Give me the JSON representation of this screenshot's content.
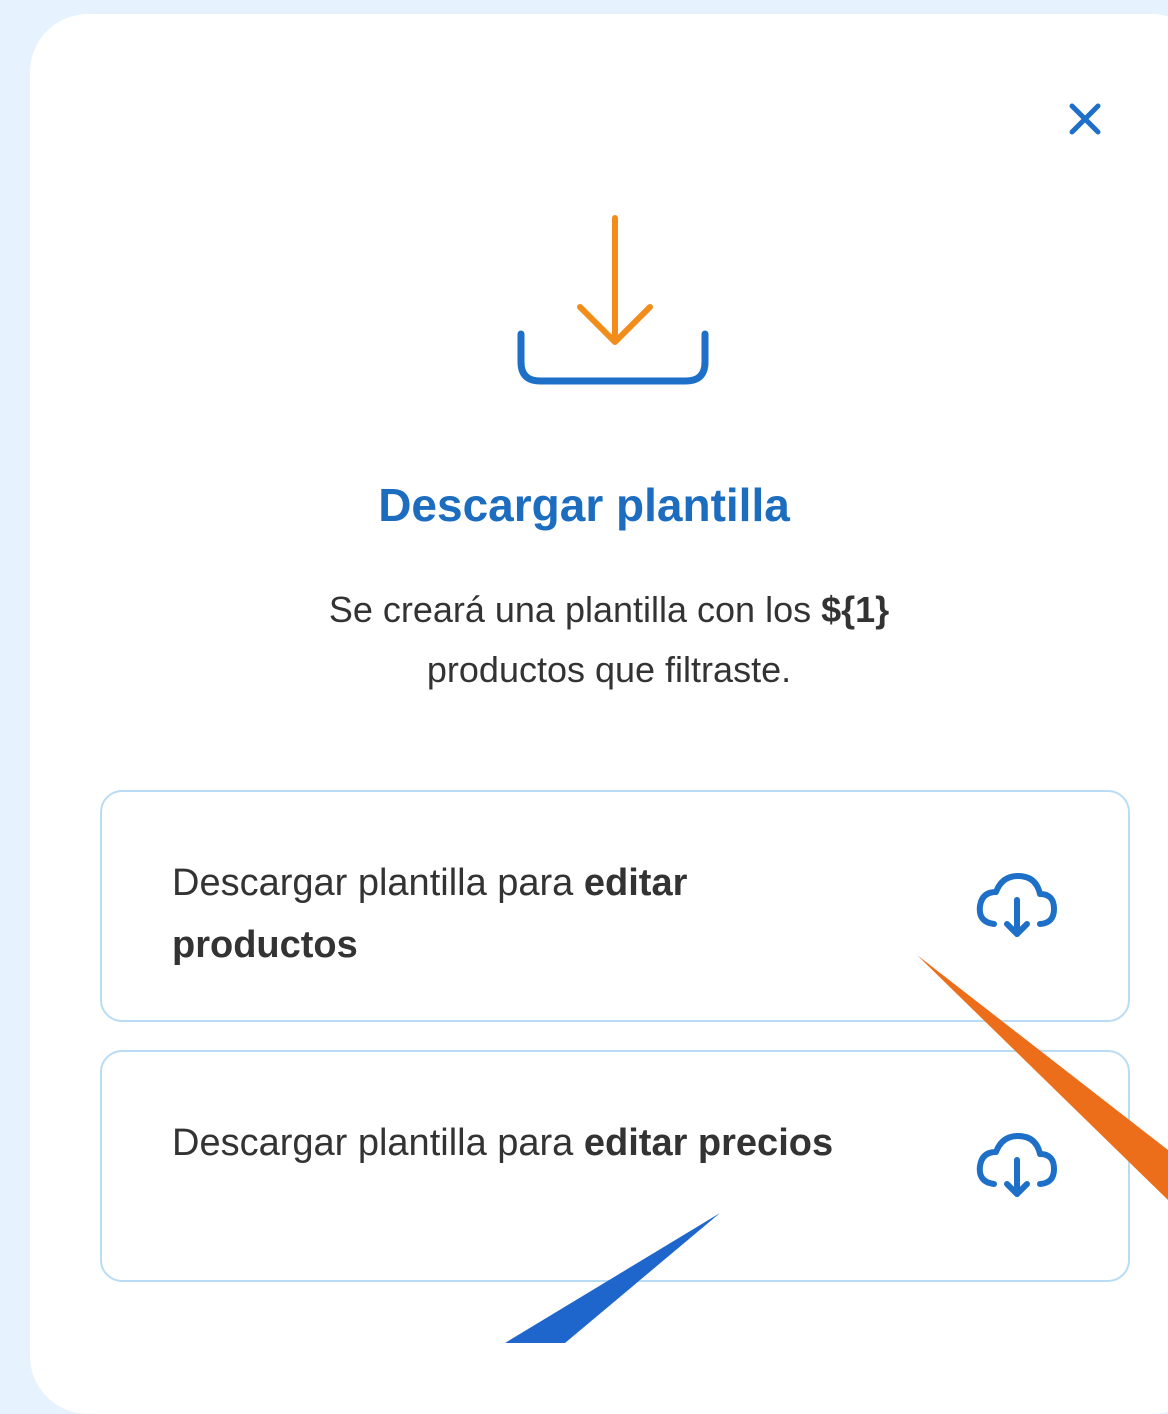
{
  "colors": {
    "background": "#e6f2fe",
    "title": "#1c6cbf",
    "accent_orange": "#f28c1a",
    "accent_blue": "#1d6fc7",
    "card_border": "#b9dcf5",
    "arrow_orange": "#ec6d1a",
    "arrow_blue": "#1f66cc"
  },
  "modal": {
    "close_icon": "close-icon",
    "hero_icon": "download-tray-icon",
    "title": "Descargar plantilla",
    "subtitle_prefix": "Se creará una plantilla con los ",
    "subtitle_bold": "${1}",
    "subtitle_suffix": " productos que filtraste."
  },
  "options": [
    {
      "text_prefix": "Descargar plantilla para ",
      "text_bold": "editar productos",
      "icon": "cloud-download-icon"
    },
    {
      "text_prefix": "Descargar plantilla para ",
      "text_bold": "editar precios",
      "icon": "cloud-download-icon"
    }
  ]
}
